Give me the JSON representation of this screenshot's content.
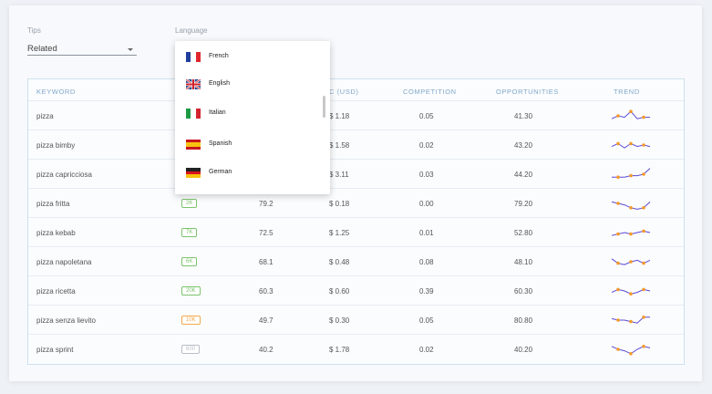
{
  "filters": {
    "tips_label": "Tips",
    "tips_value": "Related",
    "language_label": "Language"
  },
  "language_menu": {
    "options": [
      {
        "label": "French",
        "flag": "france-flag-icon"
      },
      {
        "label": "English",
        "flag": "uk-flag-icon"
      },
      {
        "label": "Italian",
        "flag": "italy-flag-icon"
      },
      {
        "label": "Spanish",
        "flag": "spain-flag-icon"
      },
      {
        "label": "German",
        "flag": "germany-flag-icon"
      }
    ]
  },
  "table": {
    "headers": [
      "KEYWORD",
      "C (USD)",
      "COMPETITION",
      "OPPORTUNITIES",
      "TREND"
    ],
    "rows": [
      {
        "keyword": "pizza",
        "volume": "",
        "score": "",
        "cpc": "$ 1.18",
        "competition": "0.05",
        "opportunities": "41.30",
        "trend": [
          3,
          5,
          4,
          8,
          3,
          4,
          4
        ]
      },
      {
        "keyword": "pizza bimby",
        "volume": "",
        "score": "",
        "cpc": "$ 1.58",
        "competition": "0.02",
        "opportunities": "43.20",
        "trend": [
          4,
          6,
          3,
          6,
          4,
          5,
          4
        ]
      },
      {
        "keyword": "pizza capricciosa",
        "volume": "",
        "score": "",
        "cpc": "$ 3.11",
        "competition": "0.03",
        "opportunities": "44.20",
        "trend": [
          3,
          3,
          3,
          4,
          4,
          5,
          9
        ]
      },
      {
        "keyword": "pizza fritta",
        "volume": "2K",
        "score": "79.2",
        "cpc": "$ 0.18",
        "competition": "0.00",
        "opportunities": "79.20",
        "trend": [
          6,
          5,
          4,
          2,
          1,
          2,
          6
        ]
      },
      {
        "keyword": "pizza kebab",
        "volume": "7K",
        "score": "72.5",
        "cpc": "$ 1.25",
        "competition": "0.01",
        "opportunities": "52.80",
        "trend": [
          3,
          4,
          5,
          4,
          5,
          6,
          5
        ]
      },
      {
        "keyword": "pizza napoletana",
        "volume": "6K",
        "score": "68.1",
        "cpc": "$ 0.48",
        "competition": "0.08",
        "opportunities": "48.10",
        "trend": [
          7,
          4,
          3,
          5,
          6,
          4,
          6
        ]
      },
      {
        "keyword": "pizza ricetta",
        "volume": "20K",
        "score": "60.3",
        "cpc": "$ 0.60",
        "competition": "0.39",
        "opportunities": "60.30",
        "trend": [
          4,
          6,
          5,
          3,
          4,
          6,
          5
        ]
      },
      {
        "keyword": "pizza senza lievito",
        "volume": "10K",
        "score": "49.7",
        "cpc": "$ 0.30",
        "competition": "0.05",
        "opportunities": "80.80",
        "trend": [
          6,
          5,
          5,
          4,
          3,
          7,
          7
        ]
      },
      {
        "keyword": "pizza sprint",
        "volume": "600",
        "score": "40.2",
        "cpc": "$ 1.78",
        "competition": "0.02",
        "opportunities": "40.20",
        "trend": [
          7,
          5,
          4,
          2,
          5,
          7,
          6
        ]
      }
    ]
  },
  "colors": {
    "trend_line": "#5b4bd6",
    "trend_dot": "#f39a2b",
    "badge_green": "#7cc46d",
    "badge_orange": "#f2a94b",
    "badge_grey": "#b9bec6"
  }
}
